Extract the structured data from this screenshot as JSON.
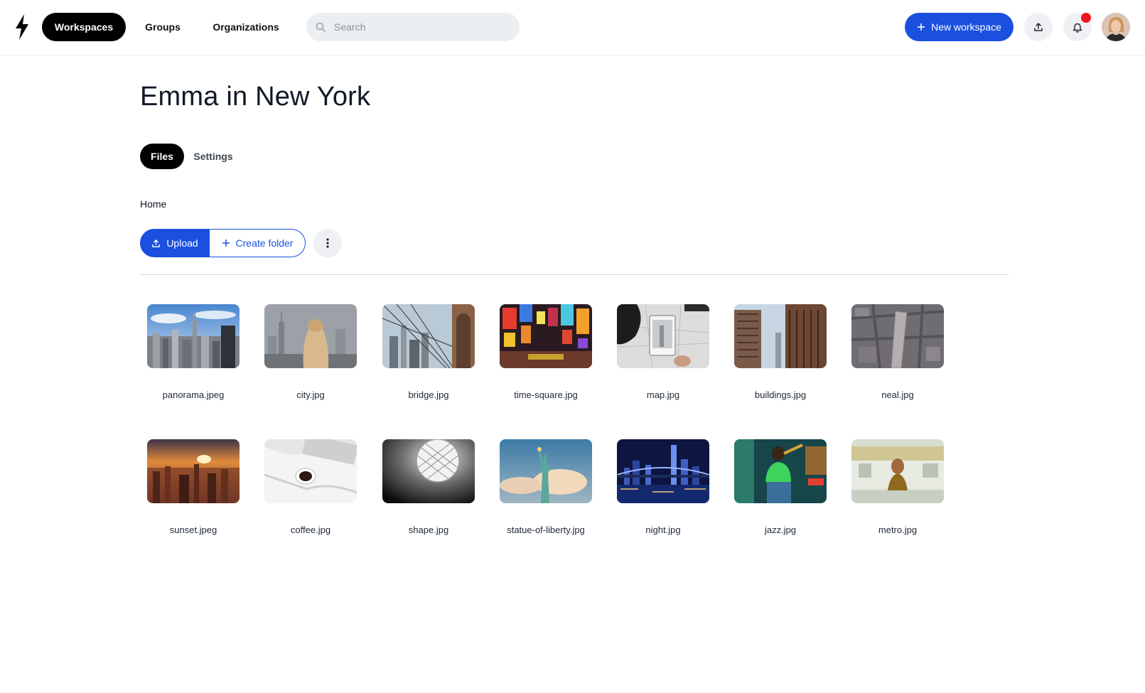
{
  "nav": {
    "workspaces": "Workspaces",
    "groups": "Groups",
    "organizations": "Organizations",
    "search_placeholder": "Search",
    "new_workspace": "New workspace"
  },
  "page": {
    "title": "Emma in New York",
    "tabs": [
      "Files",
      "Settings"
    ],
    "breadcrumb": "Home",
    "upload_label": "Upload",
    "create_folder_label": "Create folder"
  },
  "files": [
    "panorama.jpeg",
    "city.jpg",
    "bridge.jpg",
    "time-square.jpg",
    "map.jpg",
    "buildings.jpg",
    "neal.jpg",
    "sunset.jpeg",
    "coffee.jpg",
    "shape.jpg",
    "statue-of-liberty.jpg",
    "night.jpg",
    "jazz.jpg",
    "metro.jpg"
  ],
  "colors": {
    "accent": "#1a4fe0",
    "notification": "#f2141c",
    "active_pill": "#000000"
  },
  "icons": {
    "logo": "lightning-bolt-icon",
    "search": "search-icon",
    "plus": "plus-icon",
    "upload": "upload-icon",
    "bell": "bell-icon",
    "more": "more-vertical-icon"
  }
}
